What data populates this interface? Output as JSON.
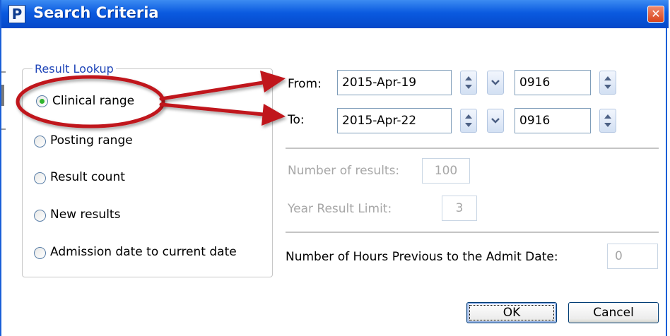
{
  "window": {
    "title": "Search Criteria",
    "app_icon_letter": "P",
    "close_glyph": "✕"
  },
  "result_lookup": {
    "legend": "Result Lookup",
    "options": [
      {
        "label": "Clinical range",
        "selected": true
      },
      {
        "label": "Posting range",
        "selected": false
      },
      {
        "label": "Result count",
        "selected": false
      },
      {
        "label": "New results",
        "selected": false
      },
      {
        "label": "Admission date to current date",
        "selected": false
      }
    ]
  },
  "from": {
    "label": "From:",
    "date": "2015-Apr-19",
    "time": "0916"
  },
  "to": {
    "label": "To:",
    "date": "2015-Apr-22",
    "time": "0916"
  },
  "number_of_results": {
    "label": "Number of results:",
    "value": "100"
  },
  "year_result_limit": {
    "label": "Year Result Limit:",
    "value": "3"
  },
  "hours_previous": {
    "label": "Number of Hours Previous to the Admit Date:",
    "value": "0"
  },
  "buttons": {
    "ok": "OK",
    "cancel": "Cancel"
  },
  "colors": {
    "title_bar": "#0a5ae0",
    "legend_text": "#1f45b8",
    "annotation": "#c0131b",
    "radio_selected": "#2fb52f"
  },
  "icons": [
    "p-app-icon",
    "close-icon",
    "spin-up-icon",
    "spin-down-icon",
    "chevron-down-icon",
    "red-arrow-annotation"
  ]
}
